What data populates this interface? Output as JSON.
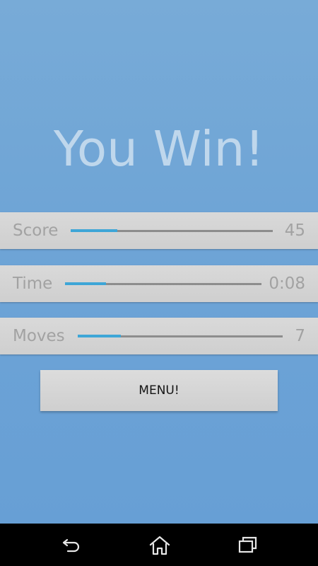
{
  "game": {
    "title": "You Win!",
    "stats": [
      {
        "label": "Score",
        "value": "45",
        "progress": 0.23
      },
      {
        "label": "Time",
        "value": "0:08",
        "progress": 0.21
      },
      {
        "label": "Moves",
        "value": "7",
        "progress": 0.21
      }
    ],
    "menu_label": "MENU!"
  },
  "navbar": {
    "back_icon": "back-arrow-icon",
    "home_icon": "home-icon",
    "recents_icon": "recent-apps-icon"
  },
  "colors": {
    "background": "#6ea4d6",
    "progress_fill": "#3ea6d7",
    "progress_track": "#8d8d8d",
    "panel": "#d4d4d4"
  }
}
